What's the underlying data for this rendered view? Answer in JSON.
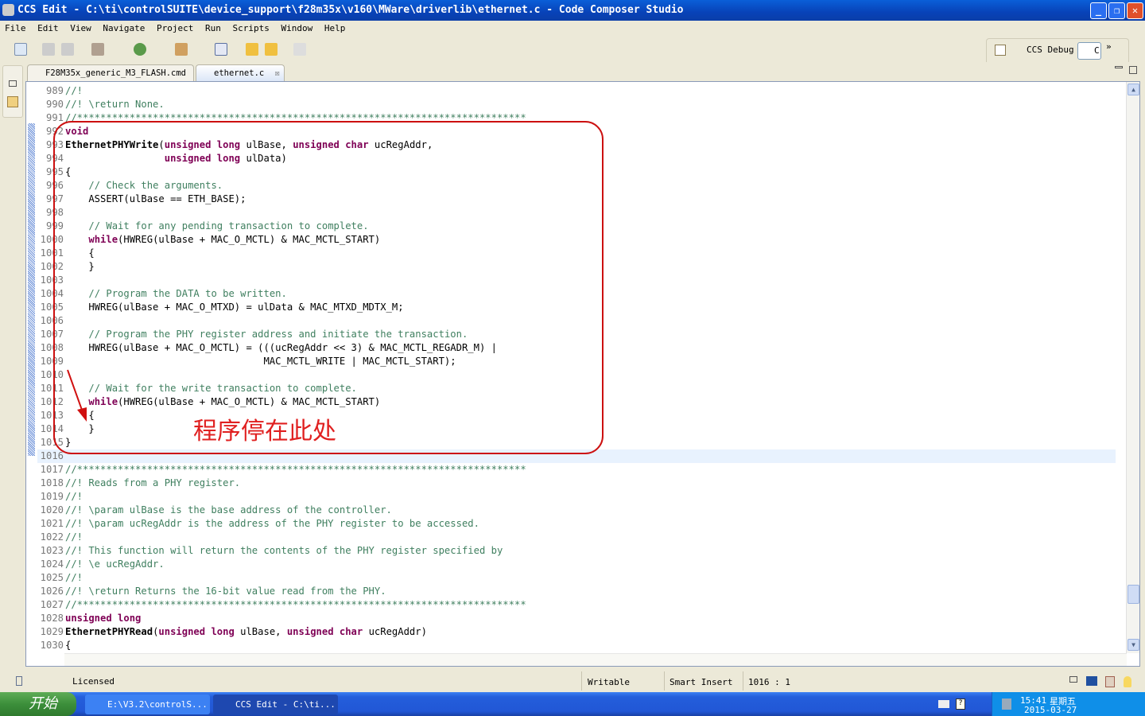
{
  "window": {
    "title": "CCS Edit - C:\\ti\\controlSUITE\\device_support\\f28m35x\\v160\\MWare\\driverlib\\ethernet.c - Code Composer Studio"
  },
  "menu": [
    "File",
    "Edit",
    "View",
    "Navigate",
    "Project",
    "Run",
    "Scripts",
    "Window",
    "Help"
  ],
  "perspectives": {
    "debug_label": "CCS Debug",
    "edit_label": "C",
    "more": "»"
  },
  "tabs": [
    {
      "label": "F28M35x_generic_M3_FLASH.cmd",
      "active": false
    },
    {
      "label": "ethernet.c",
      "active": true
    }
  ],
  "editor": {
    "current_line": "1016",
    "lines": [
      {
        "n": "989",
        "t": [
          [
            "c",
            "//!"
          ]
        ]
      },
      {
        "n": "990",
        "t": [
          [
            "c",
            "//! \\return None."
          ]
        ]
      },
      {
        "n": "991",
        "t": [
          [
            "c",
            "//*****************************************************************************"
          ]
        ]
      },
      {
        "n": "992",
        "t": [
          [
            "k",
            "void"
          ]
        ]
      },
      {
        "n": "993",
        "t": [
          [
            "f",
            "EthernetPHYWrite"
          ],
          [
            "p",
            "("
          ],
          [
            "k",
            "unsigned long"
          ],
          [
            "p",
            " ulBase, "
          ],
          [
            "k",
            "unsigned char"
          ],
          [
            "p",
            " ucRegAddr,"
          ]
        ]
      },
      {
        "n": "994",
        "t": [
          [
            "p",
            "                 "
          ],
          [
            "k",
            "unsigned long"
          ],
          [
            "p",
            " ulData)"
          ]
        ]
      },
      {
        "n": "995",
        "t": [
          [
            "p",
            "{"
          ]
        ]
      },
      {
        "n": "996",
        "t": [
          [
            "p",
            "    "
          ],
          [
            "c",
            "// Check the arguments."
          ]
        ]
      },
      {
        "n": "997",
        "t": [
          [
            "p",
            "    ASSERT(ulBase == ETH_BASE);"
          ]
        ]
      },
      {
        "n": "998",
        "t": []
      },
      {
        "n": "999",
        "t": [
          [
            "p",
            "    "
          ],
          [
            "c",
            "// Wait for any pending transaction to complete."
          ]
        ]
      },
      {
        "n": "1000",
        "t": [
          [
            "p",
            "    "
          ],
          [
            "k",
            "while"
          ],
          [
            "p",
            "(HWREG(ulBase + MAC_O_MCTL) & MAC_MCTL_START)"
          ]
        ]
      },
      {
        "n": "1001",
        "t": [
          [
            "p",
            "    {"
          ]
        ]
      },
      {
        "n": "1002",
        "t": [
          [
            "p",
            "    }"
          ]
        ]
      },
      {
        "n": "1003",
        "t": []
      },
      {
        "n": "1004",
        "t": [
          [
            "p",
            "    "
          ],
          [
            "c",
            "// Program the DATA to be written."
          ]
        ]
      },
      {
        "n": "1005",
        "t": [
          [
            "p",
            "    HWREG(ulBase + MAC_O_MTXD) = ulData & MAC_MTXD_MDTX_M;"
          ]
        ]
      },
      {
        "n": "1006",
        "t": []
      },
      {
        "n": "1007",
        "t": [
          [
            "p",
            "    "
          ],
          [
            "c",
            "// Program the PHY register address and initiate the transaction."
          ]
        ]
      },
      {
        "n": "1008",
        "t": [
          [
            "p",
            "    HWREG(ulBase + MAC_O_MCTL) = (((ucRegAddr << 3) & MAC_MCTL_REGADR_M) |"
          ]
        ]
      },
      {
        "n": "1009",
        "t": [
          [
            "p",
            "                                  MAC_MCTL_WRITE | MAC_MCTL_START);"
          ]
        ]
      },
      {
        "n": "1010",
        "t": []
      },
      {
        "n": "1011",
        "t": [
          [
            "p",
            "    "
          ],
          [
            "c",
            "// Wait for the write transaction to complete."
          ]
        ]
      },
      {
        "n": "1012",
        "t": [
          [
            "p",
            "    "
          ],
          [
            "k",
            "while"
          ],
          [
            "p",
            "(HWREG(ulBase + MAC_O_MCTL) & MAC_MCTL_START)"
          ]
        ]
      },
      {
        "n": "1013",
        "t": [
          [
            "p",
            "    {"
          ]
        ]
      },
      {
        "n": "1014",
        "t": [
          [
            "p",
            "    }"
          ]
        ]
      },
      {
        "n": "1015",
        "t": [
          [
            "p",
            "}"
          ]
        ]
      },
      {
        "n": "1016",
        "t": []
      },
      {
        "n": "1017",
        "t": [
          [
            "c",
            "//*****************************************************************************"
          ]
        ]
      },
      {
        "n": "1018",
        "t": [
          [
            "c",
            "//! Reads from a PHY register."
          ]
        ]
      },
      {
        "n": "1019",
        "t": [
          [
            "c",
            "//!"
          ]
        ]
      },
      {
        "n": "1020",
        "t": [
          [
            "c",
            "//! \\param ulBase is the base address of the controller."
          ]
        ]
      },
      {
        "n": "1021",
        "t": [
          [
            "c",
            "//! \\param ucRegAddr is the address of the PHY register to be accessed."
          ]
        ]
      },
      {
        "n": "1022",
        "t": [
          [
            "c",
            "//!"
          ]
        ]
      },
      {
        "n": "1023",
        "t": [
          [
            "c",
            "//! This function will return the contents of the PHY register specified by"
          ]
        ]
      },
      {
        "n": "1024",
        "t": [
          [
            "c",
            "//! \\e ucRegAddr."
          ]
        ]
      },
      {
        "n": "1025",
        "t": [
          [
            "c",
            "//!"
          ]
        ]
      },
      {
        "n": "1026",
        "t": [
          [
            "c",
            "//! \\return Returns the 16-bit value read from the PHY."
          ]
        ]
      },
      {
        "n": "1027",
        "t": [
          [
            "c",
            "//*****************************************************************************"
          ]
        ]
      },
      {
        "n": "1028",
        "t": [
          [
            "k",
            "unsigned long"
          ]
        ]
      },
      {
        "n": "1029",
        "t": [
          [
            "f",
            "EthernetPHYRead"
          ],
          [
            "p",
            "("
          ],
          [
            "k",
            "unsigned long"
          ],
          [
            "p",
            " ulBase, "
          ],
          [
            "k",
            "unsigned char"
          ],
          [
            "p",
            " ucRegAddr)"
          ]
        ]
      },
      {
        "n": "1030",
        "t": [
          [
            "p",
            "{"
          ]
        ]
      }
    ]
  },
  "annotation": {
    "text": "程序停在此处",
    "color": "#e02020"
  },
  "status": {
    "license": "Licensed",
    "writable": "Writable",
    "insert_mode": "Smart Insert",
    "position": "1016 : 1"
  },
  "taskbar": {
    "start": "开始",
    "tasks": [
      "E:\\V3.2\\controlS...",
      "CCS Edit - C:\\ti..."
    ],
    "time": "15:41",
    "weekday": "星期五",
    "date": "2015-03-27"
  }
}
